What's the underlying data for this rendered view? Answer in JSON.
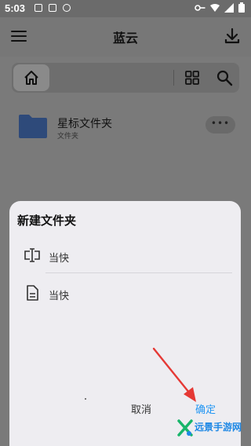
{
  "status_bar": {
    "time": "5:03"
  },
  "app_bar": {
    "title": "蓝云"
  },
  "folder": {
    "name": "星标文件夹",
    "subtitle": "文件夹",
    "more_label": "•••"
  },
  "dialog": {
    "title": "新建文件夹",
    "options": [
      {
        "label": "当快",
        "icon": "text-cursor-icon"
      },
      {
        "label": "当快",
        "icon": "document-icon"
      }
    ],
    "cancel_label": "取消",
    "confirm_label": "确定"
  },
  "watermark": {
    "text": "远景手游网"
  },
  "colors": {
    "accent": "#2196f3",
    "arrow": "#e53935",
    "folder": "#2e4a7a",
    "dialog_bg": "#eeedf1",
    "scrim": "#7a7a7a"
  }
}
